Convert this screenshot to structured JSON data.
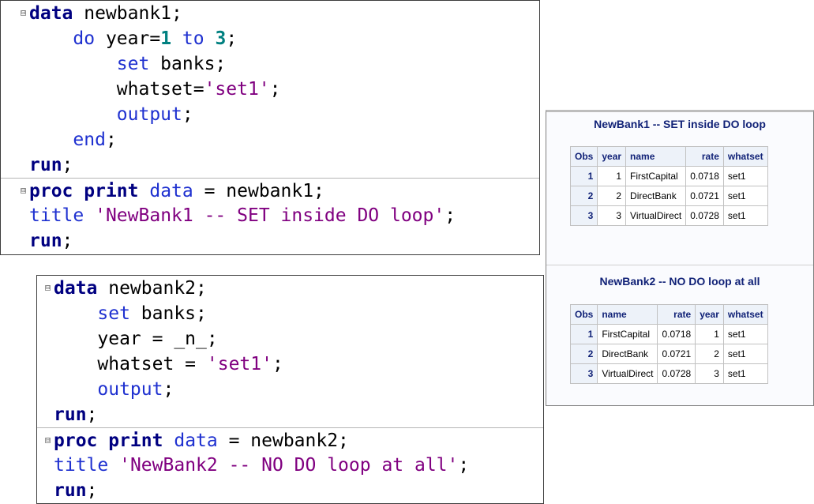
{
  "code_panel_1": {
    "lines": [
      [
        {
          "t": "data",
          "c": "kw"
        },
        {
          "t": " newbank1;",
          "c": "plain"
        }
      ],
      [
        {
          "t": "    ",
          "c": "plain"
        },
        {
          "t": "do",
          "c": "stmt"
        },
        {
          "t": " year=",
          "c": "plain"
        },
        {
          "t": "1",
          "c": "num"
        },
        {
          "t": " ",
          "c": "plain"
        },
        {
          "t": "to",
          "c": "stmt"
        },
        {
          "t": " ",
          "c": "plain"
        },
        {
          "t": "3",
          "c": "num"
        },
        {
          "t": ";",
          "c": "plain"
        }
      ],
      [
        {
          "t": "        ",
          "c": "plain"
        },
        {
          "t": "set",
          "c": "stmt"
        },
        {
          "t": " banks;",
          "c": "plain"
        }
      ],
      [
        {
          "t": "        ",
          "c": "plain"
        },
        {
          "t": "whatset=",
          "c": "plain"
        },
        {
          "t": "'set1'",
          "c": "str"
        },
        {
          "t": ";",
          "c": "plain"
        }
      ],
      [
        {
          "t": "        ",
          "c": "plain"
        },
        {
          "t": "output",
          "c": "stmt"
        },
        {
          "t": ";",
          "c": "plain"
        }
      ],
      [
        {
          "t": "    ",
          "c": "plain"
        },
        {
          "t": "end",
          "c": "stmt"
        },
        {
          "t": ";",
          "c": "plain"
        }
      ],
      [
        {
          "t": "run",
          "c": "kw"
        },
        {
          "t": ";",
          "c": "plain"
        }
      ],
      [
        {
          "t": "proc print",
          "c": "kw"
        },
        {
          "t": " ",
          "c": "plain"
        },
        {
          "t": "data",
          "c": "stmt"
        },
        {
          "t": " = newbank1;",
          "c": "plain"
        }
      ],
      [
        {
          "t": "title",
          "c": "stmt"
        },
        {
          "t": " ",
          "c": "plain"
        },
        {
          "t": "'NewBank1 -- SET inside DO loop'",
          "c": "str"
        },
        {
          "t": ";",
          "c": "plain"
        }
      ],
      [
        {
          "t": "run",
          "c": "kw"
        },
        {
          "t": ";",
          "c": "plain"
        }
      ]
    ]
  },
  "code_panel_2": {
    "lines": [
      [
        {
          "t": "data",
          "c": "kw"
        },
        {
          "t": " newbank2;",
          "c": "plain"
        }
      ],
      [
        {
          "t": "    ",
          "c": "plain"
        },
        {
          "t": "set",
          "c": "stmt"
        },
        {
          "t": " banks;",
          "c": "plain"
        }
      ],
      [
        {
          "t": "    ",
          "c": "plain"
        },
        {
          "t": "year = _n_;",
          "c": "plain"
        }
      ],
      [
        {
          "t": "    ",
          "c": "plain"
        },
        {
          "t": "whatset = ",
          "c": "plain"
        },
        {
          "t": "'set1'",
          "c": "str"
        },
        {
          "t": ";",
          "c": "plain"
        }
      ],
      [
        {
          "t": "    ",
          "c": "plain"
        },
        {
          "t": "output",
          "c": "stmt"
        },
        {
          "t": ";",
          "c": "plain"
        }
      ],
      [
        {
          "t": "run",
          "c": "kw"
        },
        {
          "t": ";",
          "c": "plain"
        }
      ],
      [
        {
          "t": "proc print",
          "c": "kw"
        },
        {
          "t": " ",
          "c": "plain"
        },
        {
          "t": "data",
          "c": "stmt"
        },
        {
          "t": " = newbank2;",
          "c": "plain"
        }
      ],
      [
        {
          "t": "title",
          "c": "stmt"
        },
        {
          "t": " ",
          "c": "plain"
        },
        {
          "t": "'NewBank2 -- NO DO loop at all'",
          "c": "str"
        },
        {
          "t": ";",
          "c": "plain"
        }
      ],
      [
        {
          "t": "run",
          "c": "kw"
        },
        {
          "t": ";",
          "c": "plain"
        }
      ]
    ]
  },
  "fold_icon_glyph": "⊟",
  "output": {
    "table1": {
      "title": "NewBank1 -- SET inside DO loop",
      "columns": [
        "Obs",
        "year",
        "name",
        "rate",
        "whatset"
      ],
      "rows": [
        [
          "1",
          "1",
          "FirstCapital",
          "0.0718",
          "set1"
        ],
        [
          "2",
          "2",
          "DirectBank",
          "0.0721",
          "set1"
        ],
        [
          "3",
          "3",
          "VirtualDirect",
          "0.0728",
          "set1"
        ]
      ]
    },
    "table2": {
      "title": "NewBank2 -- NO DO loop at all",
      "columns": [
        "Obs",
        "name",
        "rate",
        "year",
        "whatset"
      ],
      "rows": [
        [
          "1",
          "FirstCapital",
          "0.0718",
          "1",
          "set1"
        ],
        [
          "2",
          "DirectBank",
          "0.0721",
          "2",
          "set1"
        ],
        [
          "3",
          "VirtualDirect",
          "0.0728",
          "3",
          "set1"
        ]
      ]
    }
  },
  "colors": {
    "keyword_navy": "#000080",
    "statement_blue": "#1f31d0",
    "number_teal": "#008080",
    "string_purple": "#800080",
    "table_header_text": "#112277",
    "table_header_bg": "#edf2f9"
  }
}
